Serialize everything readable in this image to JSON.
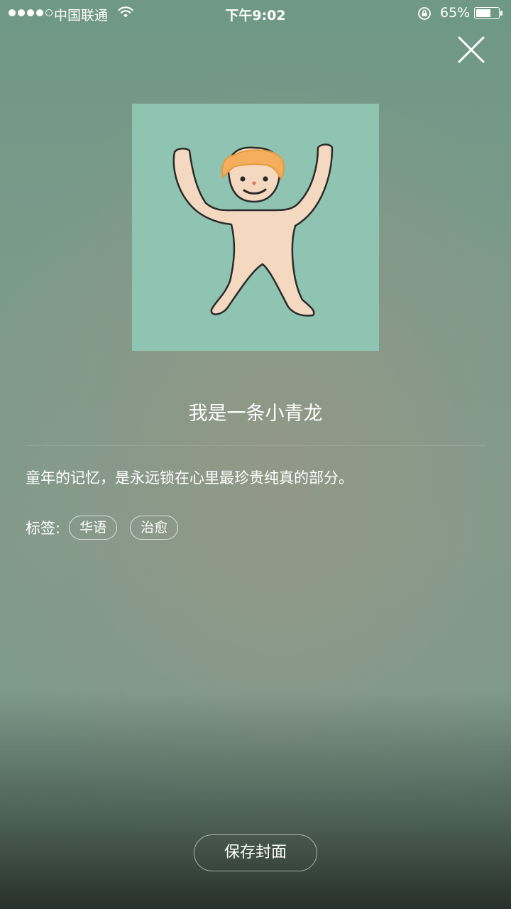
{
  "status_bar": {
    "carrier": "中国联通",
    "time": "下午9:02",
    "battery": "65%",
    "battery_level": 0.65,
    "signal_strength": 4,
    "icons": [
      "signal-dots",
      "wifi-icon",
      "orientation-lock-icon",
      "battery-icon"
    ]
  },
  "close_icon": "close-icon",
  "cover": {
    "background_color": "#8fc4b3",
    "description_icon": "cartoon-figure-illustration"
  },
  "song": {
    "title": "我是一条小青龙",
    "description": "童年的记忆，是永远锁在心里最珍贵纯真的部分。"
  },
  "tags": {
    "label": "标签:",
    "items": [
      "华语",
      "治愈"
    ]
  },
  "save_button": {
    "label": "保存封面"
  }
}
